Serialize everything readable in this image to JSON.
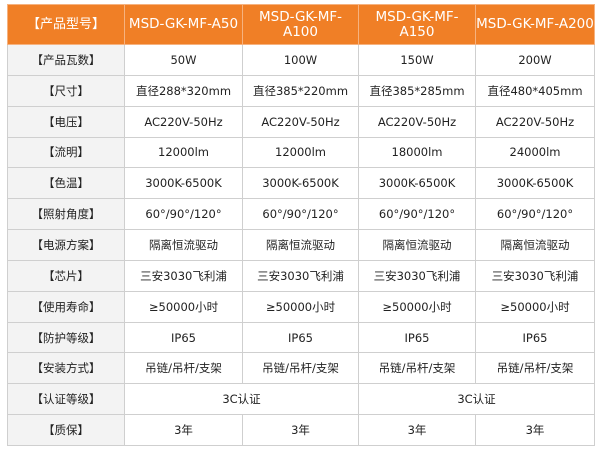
{
  "table": {
    "header_label": "【产品型号】",
    "models": [
      "MSD-GK-MF-A50",
      "MSD-GK-MF-A100",
      "MSD-GK-MF-A150",
      "MSD-GK-MF-A200"
    ],
    "rows": [
      {
        "label": "【产品瓦数】",
        "cells": [
          "50W",
          "100W",
          "150W",
          "200W"
        ]
      },
      {
        "label": "【尺寸】",
        "cells": [
          "直径288*320mm",
          "直径385*220mm",
          "直径385*285mm",
          "直径480*405mm"
        ]
      },
      {
        "label": "【电压】",
        "cells": [
          "AC220V-50Hz",
          "AC220V-50Hz",
          "AC220V-50Hz",
          "AC220V-50Hz"
        ]
      },
      {
        "label": "【流明】",
        "cells": [
          "12000lm",
          "12000lm",
          "18000lm",
          "24000lm"
        ]
      },
      {
        "label": "【色温】",
        "cells": [
          "3000K-6500K",
          "3000K-6500K",
          "3000K-6500K",
          "3000K-6500K"
        ]
      },
      {
        "label": "【照射角度】",
        "cells": [
          "60°/90°/120°",
          "60°/90°/120°",
          "60°/90°/120°",
          "60°/90°/120°"
        ]
      },
      {
        "label": "【电源方案】",
        "cells": [
          "隔离恒流驱动",
          "隔离恒流驱动",
          "隔离恒流驱动",
          "隔离恒流驱动"
        ]
      },
      {
        "label": "【芯片】",
        "cells": [
          "三安3030飞利浦",
          "三安3030飞利浦",
          "三安3030飞利浦",
          "三安3030飞利浦"
        ]
      },
      {
        "label": "【使用寿命】",
        "cells": [
          "≥50000小时",
          "≥50000小时",
          "≥50000小时",
          "≥50000小时"
        ]
      },
      {
        "label": "【防护等级】",
        "cells": [
          "IP65",
          "IP65",
          "IP65",
          "IP65"
        ]
      },
      {
        "label": "【安装方式】",
        "cells": [
          "吊链/吊杆/支架",
          "吊链/吊杆/支架",
          "吊链/吊杆/支架",
          "吊链/吊杆/支架"
        ]
      },
      {
        "label": "【认证等级】",
        "cells": [
          "3C认证",
          "3C认证"
        ],
        "merged": true
      },
      {
        "label": "【质保】",
        "cells": [
          "3年",
          "3年",
          "3年",
          "3年"
        ]
      }
    ]
  },
  "colors": {
    "header_bg": "#f07f26",
    "header_text": "#ffffff",
    "label_bg": "#f3f3f3",
    "border": "#cfcfcf"
  }
}
